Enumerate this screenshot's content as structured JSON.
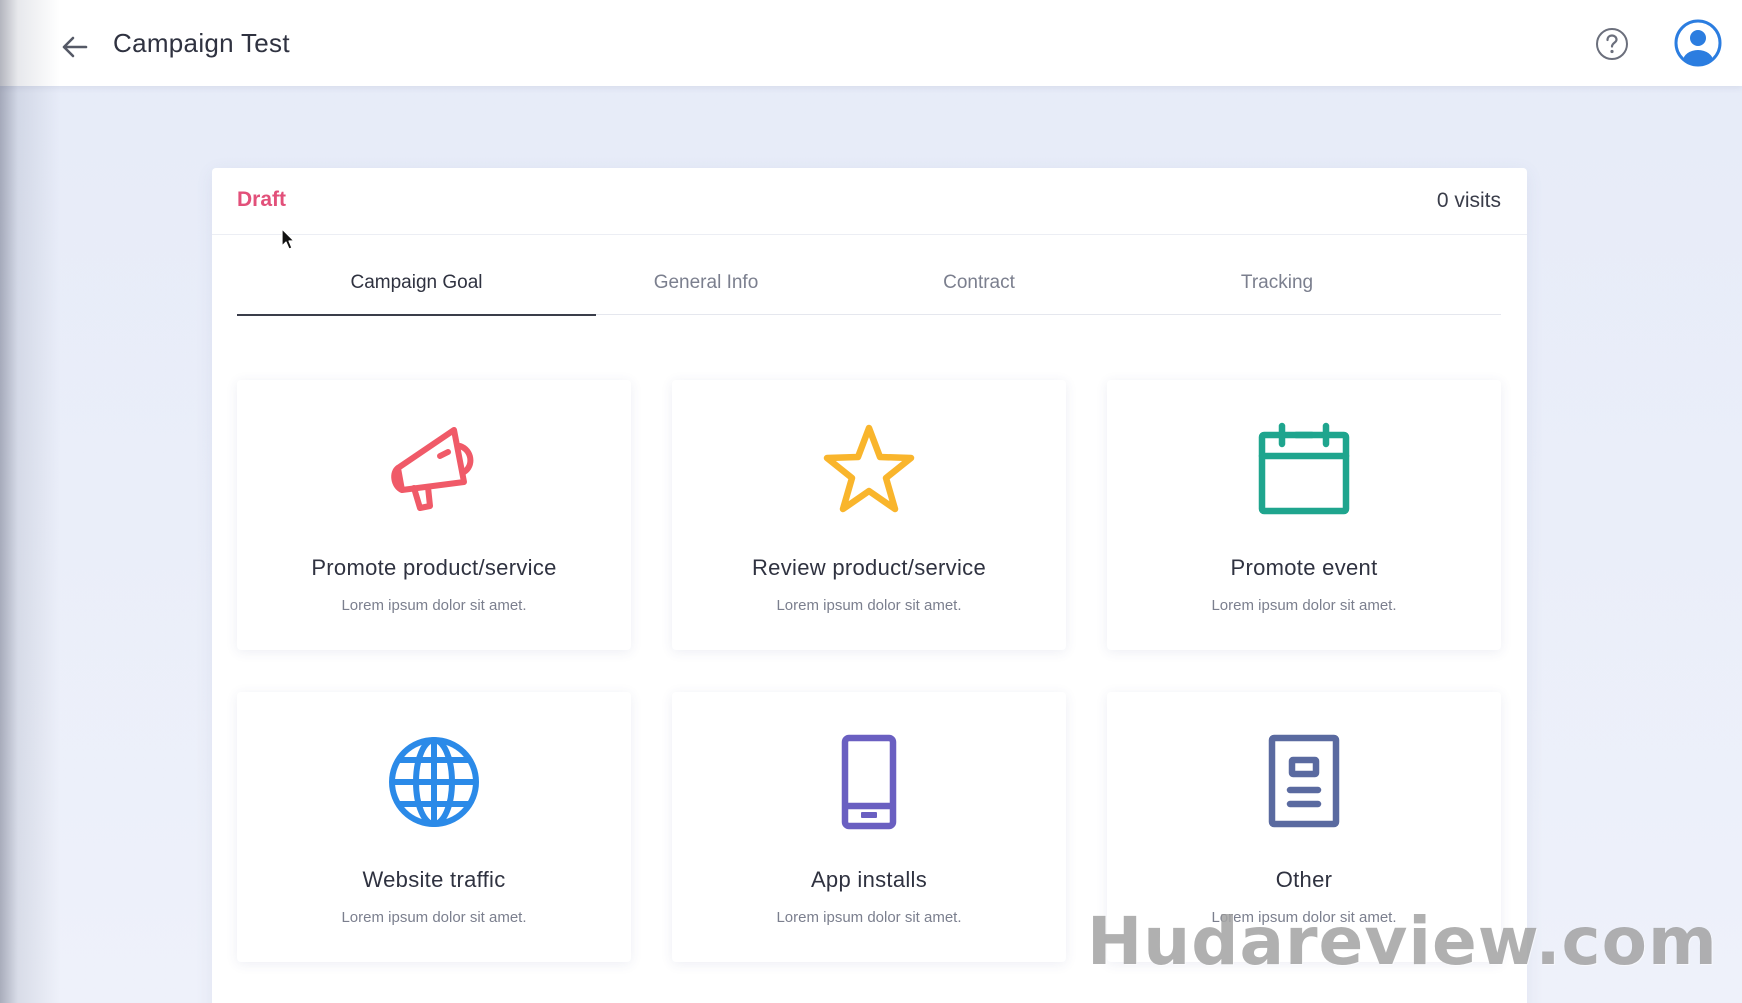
{
  "header": {
    "back_icon": "arrow-left-icon",
    "title": "Campaign Test",
    "help_icon": "question-circle-icon",
    "avatar_icon": "user-avatar-icon"
  },
  "campaign": {
    "status": "Draft",
    "status_color": "#e2507a",
    "visits": "0 visits"
  },
  "tabs": [
    {
      "label": "Campaign Goal",
      "active": true
    },
    {
      "label": "General Info",
      "active": false
    },
    {
      "label": "Contract",
      "active": false
    },
    {
      "label": "Tracking",
      "active": false
    }
  ],
  "goals": [
    {
      "title": "Promote product/service",
      "description": "Lorem ipsum dolor sit amet.",
      "icon": "megaphone-icon",
      "color": "#f05a68"
    },
    {
      "title": "Review product/service",
      "description": "Lorem ipsum dolor sit amet.",
      "icon": "star-icon",
      "color": "#f9b52c"
    },
    {
      "title": "Promote event",
      "description": "Lorem ipsum dolor sit amet.",
      "icon": "calendar-icon",
      "color": "#1fa58e"
    },
    {
      "title": "Website traffic",
      "description": "Lorem ipsum dolor sit amet.",
      "icon": "globe-icon",
      "color": "#2b8ae8"
    },
    {
      "title": "App installs",
      "description": "Lorem ipsum dolor sit amet.",
      "icon": "smartphone-icon",
      "color": "#6a5fc1"
    },
    {
      "title": "Other",
      "description": "Lorem ipsum dolor sit amet.",
      "icon": "document-icon",
      "color": "#5a6aa0"
    }
  ],
  "watermark": "Hudareview.com"
}
